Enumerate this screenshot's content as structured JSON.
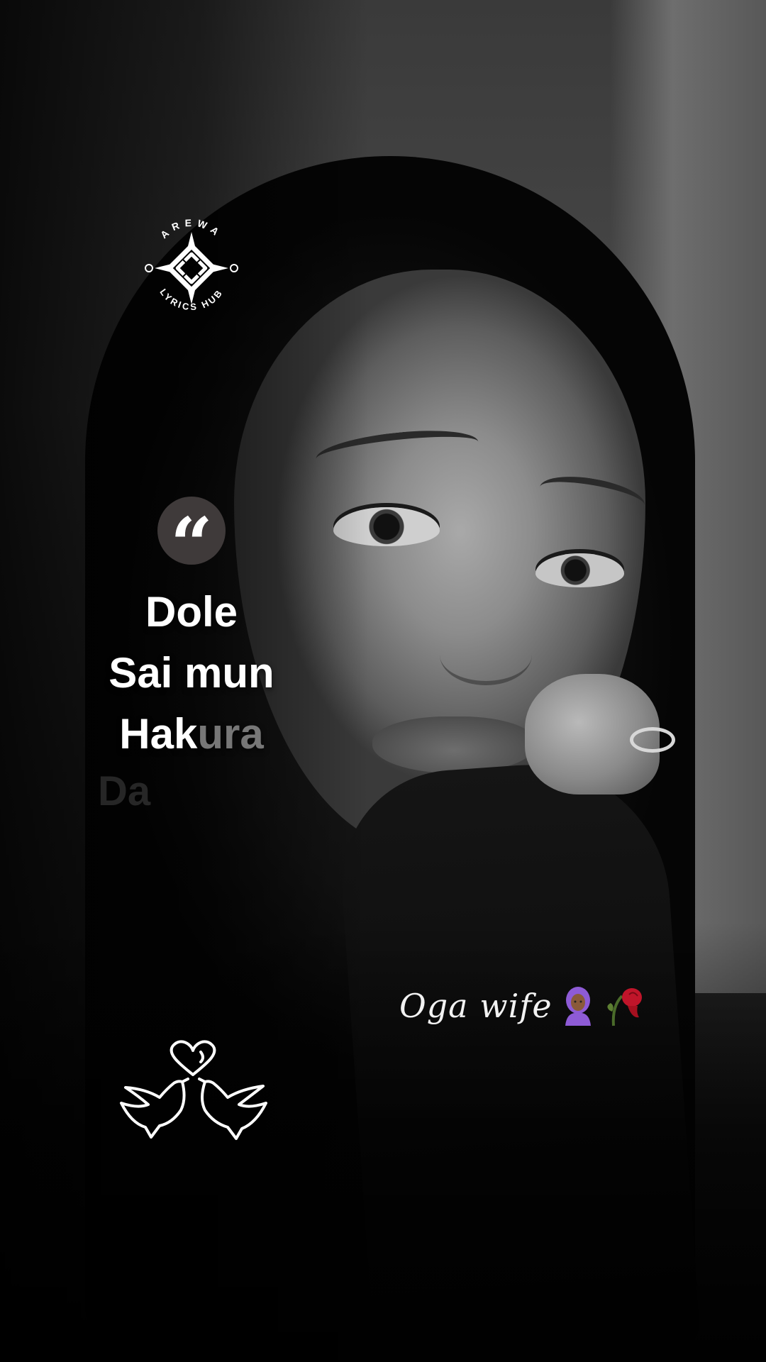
{
  "logo": {
    "top_text": "AREWA",
    "bottom_text": "LYRICS HUB",
    "icon": "celtic-knot-logo"
  },
  "quote": {
    "icon": "quote-open-icon",
    "glyph": "“"
  },
  "lyrics": {
    "lines": [
      "Dole",
      "Sai mun"
    ],
    "line3_visible": "Hak",
    "line3_fading": "ura",
    "faded_next_line": "Da"
  },
  "signature": {
    "text": "Oga wife",
    "emojis": [
      "woman-with-headscarf-icon",
      "wilted-rose-icon"
    ]
  },
  "decor": {
    "doves": "doves-with-heart-icon"
  },
  "colors": {
    "badge": "#3f3a3a",
    "text": "#ffffff",
    "rose": "#c0152a",
    "hijab_emoji": "#8e5bd6"
  }
}
